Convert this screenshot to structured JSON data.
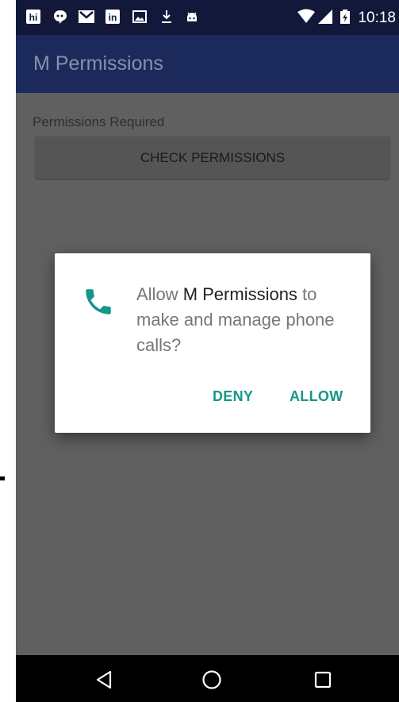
{
  "status_bar": {
    "time": "10:18",
    "icons": [
      "hangouts-icon",
      "messenger-icon",
      "gmail-icon",
      "linkedin-icon",
      "image-icon",
      "download-icon",
      "android-icon",
      "wifi-icon",
      "signal-icon",
      "battery-icon"
    ]
  },
  "app_bar": {
    "title": "M Permissions"
  },
  "main": {
    "permissions_label": "Permissions Required",
    "check_button_label": "CHECK PERMISSIONS"
  },
  "dialog": {
    "message_prefix": "Allow ",
    "app_name": "M Permissions",
    "message_suffix": " to make and manage phone calls?",
    "deny_label": "DENY",
    "allow_label": "ALLOW",
    "icon": "phone-icon",
    "accent_color": "#17968a"
  },
  "nav_bar": {
    "icons": [
      "back-icon",
      "home-icon",
      "recents-icon"
    ]
  },
  "colors": {
    "app_bar": "#1b2a5b",
    "status_bar": "#11183a",
    "scrim": "#606060"
  }
}
